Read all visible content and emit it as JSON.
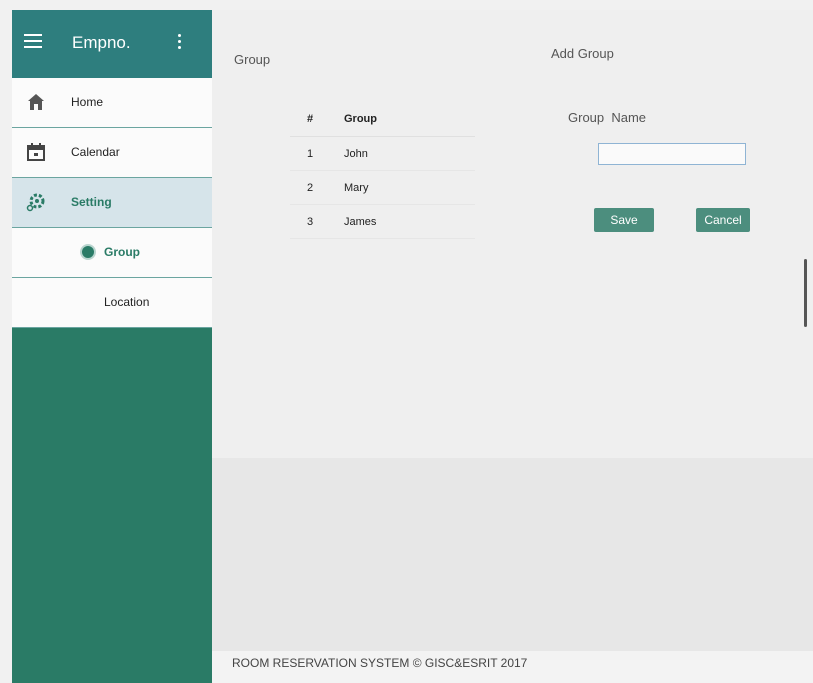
{
  "header": {
    "brand": "Empno."
  },
  "nav": {
    "items": [
      {
        "label": "Home",
        "icon": "home-icon"
      },
      {
        "label": "Calendar",
        "icon": "calendar-icon"
      },
      {
        "label": "Setting",
        "icon": "gear-icon"
      },
      {
        "label": "Group",
        "icon": "radio-dot-icon"
      },
      {
        "label": "Location"
      }
    ]
  },
  "group_panel": {
    "title": "Group",
    "table": {
      "headers": [
        "#",
        "Group"
      ],
      "rows": [
        {
          "num": "1",
          "name": "John"
        },
        {
          "num": "2",
          "name": "Mary"
        },
        {
          "num": "3",
          "name": "James"
        }
      ]
    }
  },
  "add_group": {
    "title": "Add Group",
    "field_label": "Group  Name",
    "field_value": "",
    "save_label": "Save",
    "cancel_label": "Cancel"
  },
  "footer": {
    "text": "ROOM RESERVATION SYSTEM © GISC&ESRIT 2017"
  },
  "colors": {
    "sidebar": "#2a7b66",
    "topbar": "#2e7e7e",
    "active_item": "#d6e4ea",
    "button": "#4c8e7e"
  }
}
